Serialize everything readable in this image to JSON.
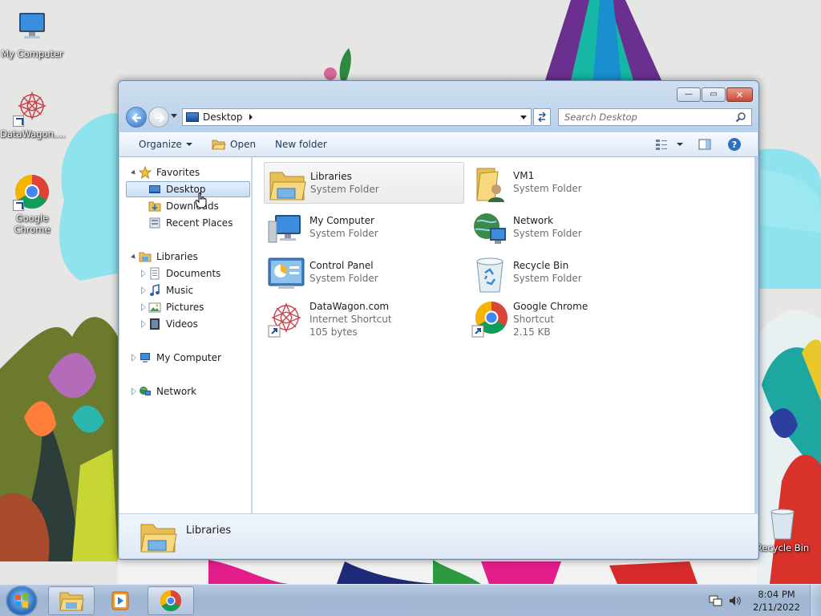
{
  "desktop": {
    "icons": [
      {
        "label": "My Computer",
        "icon": "computer-icon"
      },
      {
        "label": "DataWagon....",
        "icon": "datawagon-shortcut-icon"
      },
      {
        "label": "Google Chrome",
        "icon": "chrome-shortcut-icon"
      },
      {
        "label": "Recycle Bin",
        "icon": "recycle-bin-icon"
      }
    ]
  },
  "window": {
    "caption_buttons": {
      "minimize": "—",
      "maximize": "▭",
      "close": "✕"
    },
    "address": {
      "crumb": "Desktop"
    },
    "search": {
      "placeholder": "Search Desktop"
    },
    "toolbar": {
      "organize": "Organize",
      "open": "Open",
      "new_folder": "New folder"
    },
    "nav": {
      "favorites": "Favorites",
      "desktop": "Desktop",
      "downloads": "Downloads",
      "recent_places": "Recent Places",
      "libraries": "Libraries",
      "documents": "Documents",
      "music": "Music",
      "pictures": "Pictures",
      "videos": "Videos",
      "my_computer": "My Computer",
      "network": "Network"
    },
    "items": [
      {
        "name": "Libraries",
        "line2": "System Folder",
        "line3": "",
        "icon": "libraries-folder-icon",
        "selected": true
      },
      {
        "name": "VM1",
        "line2": "System Folder",
        "line3": "",
        "icon": "user-folder-icon"
      },
      {
        "name": "My Computer",
        "line2": "System Folder",
        "line3": "",
        "icon": "computer-icon"
      },
      {
        "name": "Network",
        "line2": "System Folder",
        "line3": "",
        "icon": "network-icon"
      },
      {
        "name": "Control Panel",
        "line2": "System Folder",
        "line3": "",
        "icon": "control-panel-icon"
      },
      {
        "name": "Recycle Bin",
        "line2": "System Folder",
        "line3": "",
        "icon": "recycle-bin-icon"
      },
      {
        "name": "DataWagon.com",
        "line2": "Internet Shortcut",
        "line3": "105 bytes",
        "icon": "datawagon-shortcut-icon"
      },
      {
        "name": "Google Chrome",
        "line2": "Shortcut",
        "line3": "2.15 KB",
        "icon": "chrome-shortcut-icon"
      }
    ],
    "details": {
      "name": "Libraries"
    }
  },
  "taskbar": {
    "clock": {
      "time": "8:04 PM",
      "date": "2/11/2022"
    }
  },
  "colors": {
    "accent": "#3b78c8",
    "selection": "#cce0f7",
    "window_frame": "#b9d1ea"
  }
}
